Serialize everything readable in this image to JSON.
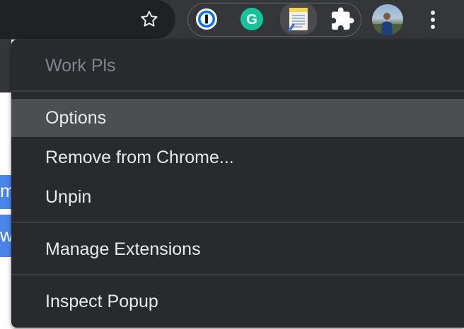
{
  "toolbar": {
    "bookmark_icon": "star-outline-icon",
    "extensions": [
      {
        "name": "1password-icon",
        "color": "#0572ec"
      },
      {
        "name": "grammarly-icon",
        "color": "#15c39a"
      },
      {
        "name": "notepad-extension-icon",
        "color": "#f6d74b"
      },
      {
        "name": "puzzle-extensions-icon",
        "color": "#ffffff"
      }
    ],
    "menu_icon": "three-dot-menu-icon"
  },
  "context_menu": {
    "header": "Work Pls",
    "items": [
      {
        "label": "Options",
        "highlighted": true
      },
      {
        "label": "Remove from Chrome..."
      },
      {
        "label": "Unpin"
      },
      {
        "label": "Manage Extensions"
      },
      {
        "label": "Inspect Popup"
      }
    ]
  },
  "page_peek": {
    "text_a": "m",
    "text_b": "w"
  },
  "colors": {
    "toolbar_bg": "#35363a",
    "menu_bg": "#292a2d",
    "highlight": "#4d4e52",
    "accent_blue": "#4a86e8"
  }
}
